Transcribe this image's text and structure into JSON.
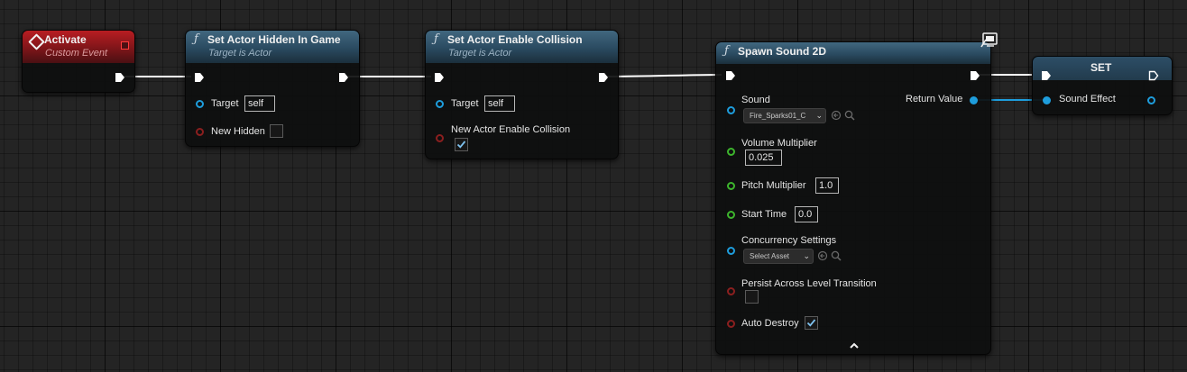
{
  "nodes": {
    "activate": {
      "title": "Activate",
      "subtitle": "Custom Event",
      "icon": "event-diamond-icon"
    },
    "set_hidden": {
      "title": "Set Actor Hidden In Game",
      "subtitle": "Target is Actor",
      "icon": "function-icon",
      "pins": {
        "target_label": "Target",
        "target_value": "self",
        "hidden_label": "New Hidden",
        "hidden_checked": false
      }
    },
    "set_collision": {
      "title": "Set Actor Enable Collision",
      "subtitle": "Target is Actor",
      "icon": "function-icon",
      "pins": {
        "target_label": "Target",
        "target_value": "self",
        "collision_label": "New Actor Enable Collision",
        "collision_checked": true
      }
    },
    "spawn_sound": {
      "title": "Spawn Sound 2D",
      "icon": "function-icon",
      "client_icon": "monitor-icon",
      "pins": {
        "sound_label": "Sound",
        "sound_value": "Fire_Sparks01_C",
        "return_label": "Return Value",
        "volume_label": "Volume Multiplier",
        "volume_value": "0.025",
        "pitch_label": "Pitch Multiplier",
        "pitch_value": "1.0",
        "start_label": "Start Time",
        "start_value": "0.0",
        "concurrency_label": "Concurrency Settings",
        "concurrency_value": "Select Asset",
        "persist_label": "Persist Across Level Transition",
        "persist_checked": false,
        "destroy_label": "Auto Destroy",
        "destroy_checked": true,
        "advanced_icon": "chevron-up-icon"
      }
    },
    "set_var": {
      "title": "SET",
      "pins": {
        "var_label": "Sound Effect"
      }
    }
  },
  "colors": {
    "exec_wire": "#ffffff",
    "object_wire": "#1e9ddc",
    "bool_pin": "#8b1f1f",
    "float_pin": "#3db52d",
    "function_header": "#2a4a60",
    "event_header": "#7e1519"
  }
}
